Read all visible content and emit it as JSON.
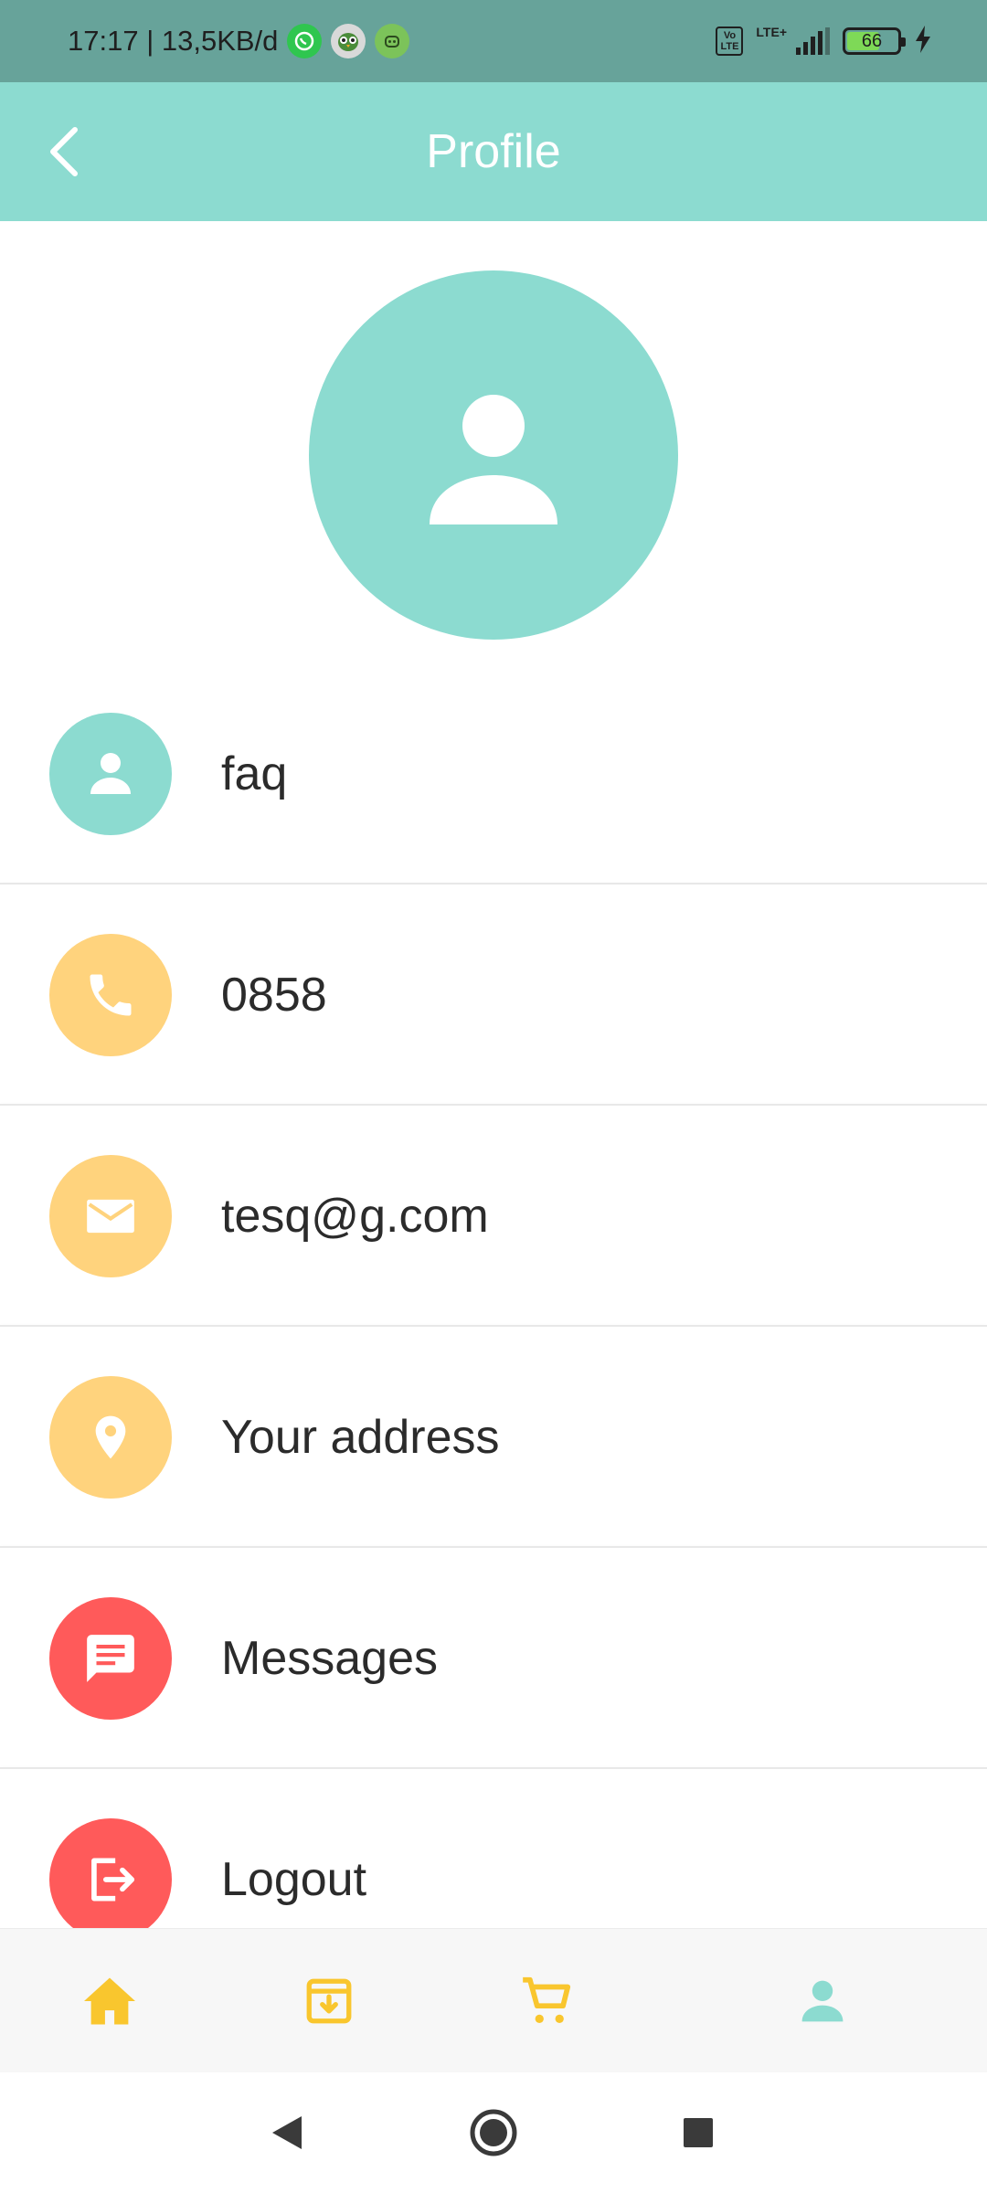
{
  "status_bar": {
    "time_speed": "17:17 | 13,5KB/d",
    "volte": "Vo\nLTE",
    "lte": "LTE+",
    "battery": "66",
    "icons": [
      "whatsapp-icon",
      "owl-app-icon",
      "robot-app-icon",
      "charging-icon"
    ]
  },
  "app_bar": {
    "title": "Profile",
    "back_icon": "back-arrow-icon"
  },
  "avatar": {
    "icon": "person-icon",
    "color": "#8cdbd0"
  },
  "profile_items": [
    {
      "label": "faq",
      "icon": "person-icon",
      "color": "#8cdbd0"
    },
    {
      "label": "0858",
      "icon": "phone-icon",
      "color": "#ffd37d"
    },
    {
      "label": "tesq@g.com",
      "icon": "mail-icon",
      "color": "#ffd37d"
    },
    {
      "label": "Your address",
      "icon": "location-pin-icon",
      "color": "#ffd37d"
    },
    {
      "label": "Messages",
      "icon": "message-icon",
      "color": "#ff5a5a"
    },
    {
      "label": "Logout",
      "icon": "logout-icon",
      "color": "#ff5a5a"
    }
  ],
  "bottom_nav": {
    "items": [
      {
        "icon": "home-icon",
        "active": false
      },
      {
        "icon": "archive-download-icon",
        "active": false
      },
      {
        "icon": "cart-icon",
        "active": false
      },
      {
        "icon": "person-icon",
        "active": true
      }
    ],
    "accent_color": "#f9c62e",
    "active_color": "#8cdbd0"
  },
  "system_nav": {
    "icons": [
      "back-triangle-icon",
      "home-circle-icon",
      "recents-square-icon"
    ]
  }
}
